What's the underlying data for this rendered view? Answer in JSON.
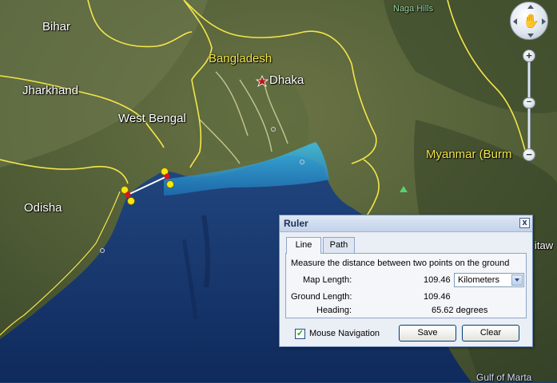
{
  "map": {
    "places": [
      {
        "key": "bihar",
        "label": "Bihar"
      },
      {
        "key": "jharkhand",
        "label": "Jharkhand"
      },
      {
        "key": "west_bengal",
        "label": "West Bengal"
      },
      {
        "key": "odisha",
        "label": "Odisha"
      },
      {
        "key": "bangladesh",
        "label": "Bangladesh"
      },
      {
        "key": "dhaka",
        "label": "Dhaka"
      },
      {
        "key": "myanmar",
        "label": "Myanmar (Burm"
      },
      {
        "key": "naga_hills",
        "label": "Naga Hills"
      },
      {
        "key": "itaw",
        "label": "itaw"
      },
      {
        "key": "gulf_martaban",
        "label": "Gulf of Marta"
      }
    ]
  },
  "navigation": {
    "zoom_in": "+",
    "zoom_out": "−",
    "zoom_level_fraction": 0.47,
    "hand_icon": "hand-icon"
  },
  "ruler": {
    "title": "Ruler",
    "close": "x",
    "tabs": [
      {
        "label": "Line",
        "active": true
      },
      {
        "label": "Path",
        "active": false
      }
    ],
    "description": "Measure the distance between two points on the ground",
    "map_length_label": "Map Length:",
    "map_length_value": "109.46",
    "unit": "Kilometers",
    "ground_length_label": "Ground Length:",
    "ground_length_value": "109.46",
    "heading_label": "Heading:",
    "heading_value": "65.62 degrees",
    "mouse_navigation_label": "Mouse Navigation",
    "mouse_navigation_checked": true,
    "save_label": "Save",
    "clear_label": "Clear"
  },
  "colors": {
    "border_yellow": "#f3e64a",
    "ruler_line": "#ffffff",
    "handle": "#f5e60c",
    "endpoint": "#e0141a"
  }
}
